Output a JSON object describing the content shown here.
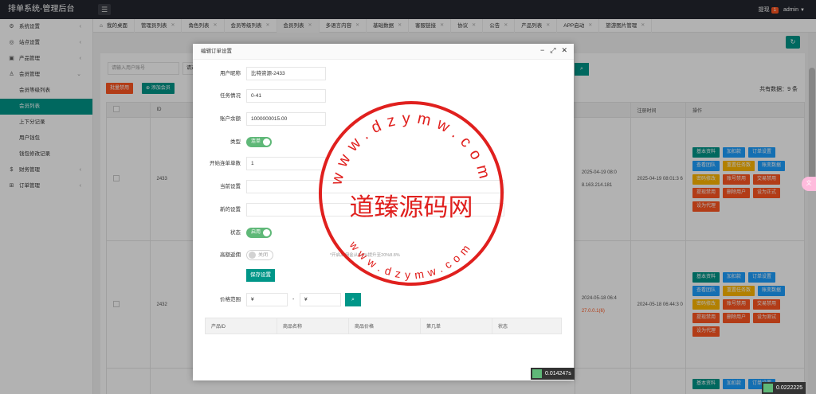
{
  "app": {
    "title": "排单系统-管理后台",
    "menu_icon": "menu-icon"
  },
  "topbar": {
    "withdraw_label": "提现",
    "withdraw_count": "1",
    "user": "admin"
  },
  "sidebar": {
    "items": [
      {
        "label": "系统设置",
        "icon": "gear-icon",
        "glyph": "⚙"
      },
      {
        "label": "站点设置",
        "icon": "globe-icon",
        "glyph": "◎"
      },
      {
        "label": "产品管理",
        "icon": "box-icon",
        "glyph": "▣"
      },
      {
        "label": "会员管理",
        "icon": "user-icon",
        "glyph": "♙"
      }
    ],
    "sub_items": [
      "会员等级列表",
      "会员列表",
      "上下分记录",
      "用户钱包",
      "钱包修改记录"
    ],
    "bottom_items": [
      {
        "label": "财务管理",
        "icon": "money-icon",
        "glyph": "$"
      },
      {
        "label": "订单管理",
        "icon": "order-icon",
        "glyph": "⊞"
      }
    ]
  },
  "tabs": [
    "我的桌面",
    "管理员列表",
    "角色列表",
    "会员等级列表",
    "会员列表",
    "多语言内容",
    "基础数据",
    "客服链接",
    "协议",
    "公告",
    "产品列表",
    "APP启动",
    "旅游图片管理"
  ],
  "main": {
    "search_placeholder": "请输入用户账号",
    "search_prefix": "请选",
    "bulk_disable": "批量禁用",
    "add_member": "添加会员",
    "total": "共有数据：9 条",
    "table_headers": {
      "id": "ID",
      "reg_time": "注册时间",
      "ops": "操作"
    },
    "rows": [
      {
        "id": "2433",
        "time_a": "2025-04-19 08:0",
        "ip": "8.163.214.181",
        "reg_time": "2025-04-19 08:01:3 6"
      },
      {
        "id": "2432",
        "time_a": "2024-05-18 06:4",
        "ip": "27.0.0.1(6)",
        "reg_time": "2024-05-18 06:44:3 0"
      }
    ],
    "row_buttons": [
      {
        "label": "基本资料",
        "color": "#009688"
      },
      {
        "label": "加扣款",
        "color": "#1e9fff"
      },
      {
        "label": "订单设置",
        "color": "#1e9fff"
      },
      {
        "label": "查看团队",
        "color": "#1e9fff"
      },
      {
        "label": "重置任务数",
        "color": "#ffb800"
      },
      {
        "label": "账变数据",
        "color": "#1e9fff"
      },
      {
        "label": "密码修改",
        "color": "#ffb800"
      },
      {
        "label": "账号禁用",
        "color": "#ff5722"
      },
      {
        "label": "交易禁用",
        "color": "#ff5722"
      },
      {
        "label": "提现禁用",
        "color": "#ff5722"
      },
      {
        "label": "删除用户",
        "color": "#ff5722"
      },
      {
        "label": "设为正式",
        "color": "#ff5722"
      },
      {
        "label": "设为代理",
        "color": "#ff5722"
      }
    ],
    "row_buttons_2_extra": "设为测试"
  },
  "dialog": {
    "title": "编辑订单设置",
    "fields": {
      "username_label": "用户昵称",
      "username": "比特资源-2433",
      "task_label": "任务情况",
      "task": "0-41",
      "balance_label": "账户余额",
      "balance": "1000000015.00",
      "type_label": "类型",
      "type_switch": "连单",
      "start_label": "开始连单单数",
      "start": "1",
      "current_label": "当前设置",
      "current": "",
      "new_label": "新的设置",
      "new": "",
      "status_label": "状态",
      "status_switch": "启用",
      "high_label": "高额返佣",
      "high_switch": "关闭",
      "hint": "*开启后佣金从8.8%提升至20%8.8%",
      "save": "保存设置",
      "price_label": "价格范围",
      "price_min": "¥",
      "price_max": "¥",
      "price_sep": "-"
    },
    "sub_headers": [
      "产品ID",
      "商品名称",
      "商品价格",
      "第几单",
      "状态"
    ]
  },
  "watermark": {
    "text": "道臻源码网",
    "url": "www.dzymw.com"
  },
  "timing": {
    "a": "0.014247s",
    "b": "0.0222225"
  },
  "float_icon": "translate-icon"
}
